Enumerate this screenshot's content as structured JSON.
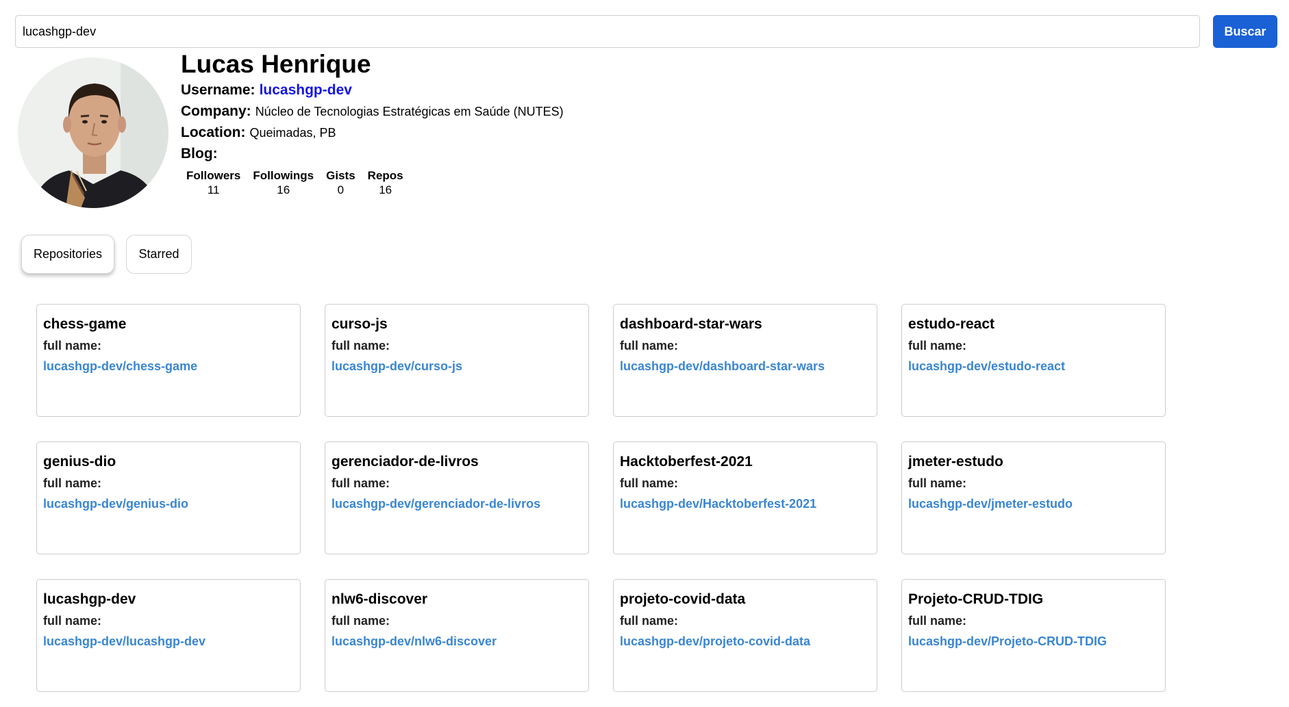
{
  "search": {
    "value": "lucashgp-dev",
    "button_label": "Buscar"
  },
  "profile": {
    "name": "Lucas Henrique",
    "username_label": "Username:",
    "username": "lucashgp-dev",
    "company_label": "Company:",
    "company": "Núcleo de Tecnologias Estratégicas em Saúde (NUTES)",
    "location_label": "Location:",
    "location": "Queimadas, PB",
    "blog_label": "Blog:",
    "blog": ""
  },
  "stats": [
    {
      "label": "Followers",
      "value": "11"
    },
    {
      "label": "Followings",
      "value": "16"
    },
    {
      "label": "Gists",
      "value": "0"
    },
    {
      "label": "Repos",
      "value": "16"
    }
  ],
  "tabs": [
    {
      "label": "Repositories"
    },
    {
      "label": "Starred"
    }
  ],
  "repo_card": {
    "full_name_label": "full name:"
  },
  "repos": [
    {
      "name": "chess-game",
      "full_name": "lucashgp-dev/chess-game"
    },
    {
      "name": "curso-js",
      "full_name": "lucashgp-dev/curso-js"
    },
    {
      "name": "dashboard-star-wars",
      "full_name": "lucashgp-dev/dashboard-star-wars"
    },
    {
      "name": "estudo-react",
      "full_name": "lucashgp-dev/estudo-react"
    },
    {
      "name": "genius-dio",
      "full_name": "lucashgp-dev/genius-dio"
    },
    {
      "name": "gerenciador-de-livros",
      "full_name": "lucashgp-dev/gerenciador-de-livros"
    },
    {
      "name": "Hacktoberfest-2021",
      "full_name": "lucashgp-dev/Hacktoberfest-2021"
    },
    {
      "name": "jmeter-estudo",
      "full_name": "lucashgp-dev/jmeter-estudo"
    },
    {
      "name": "lucashgp-dev",
      "full_name": "lucashgp-dev/lucashgp-dev"
    },
    {
      "name": "nlw6-discover",
      "full_name": "lucashgp-dev/nlw6-discover"
    },
    {
      "name": "projeto-covid-data",
      "full_name": "lucashgp-dev/projeto-covid-data"
    },
    {
      "name": "Projeto-CRUD-TDIG",
      "full_name": "lucashgp-dev/Projeto-CRUD-TDIG"
    }
  ],
  "colors": {
    "accent": "#1a61d6",
    "username_link": "#1414e6",
    "repo_link": "#3a86d1"
  }
}
